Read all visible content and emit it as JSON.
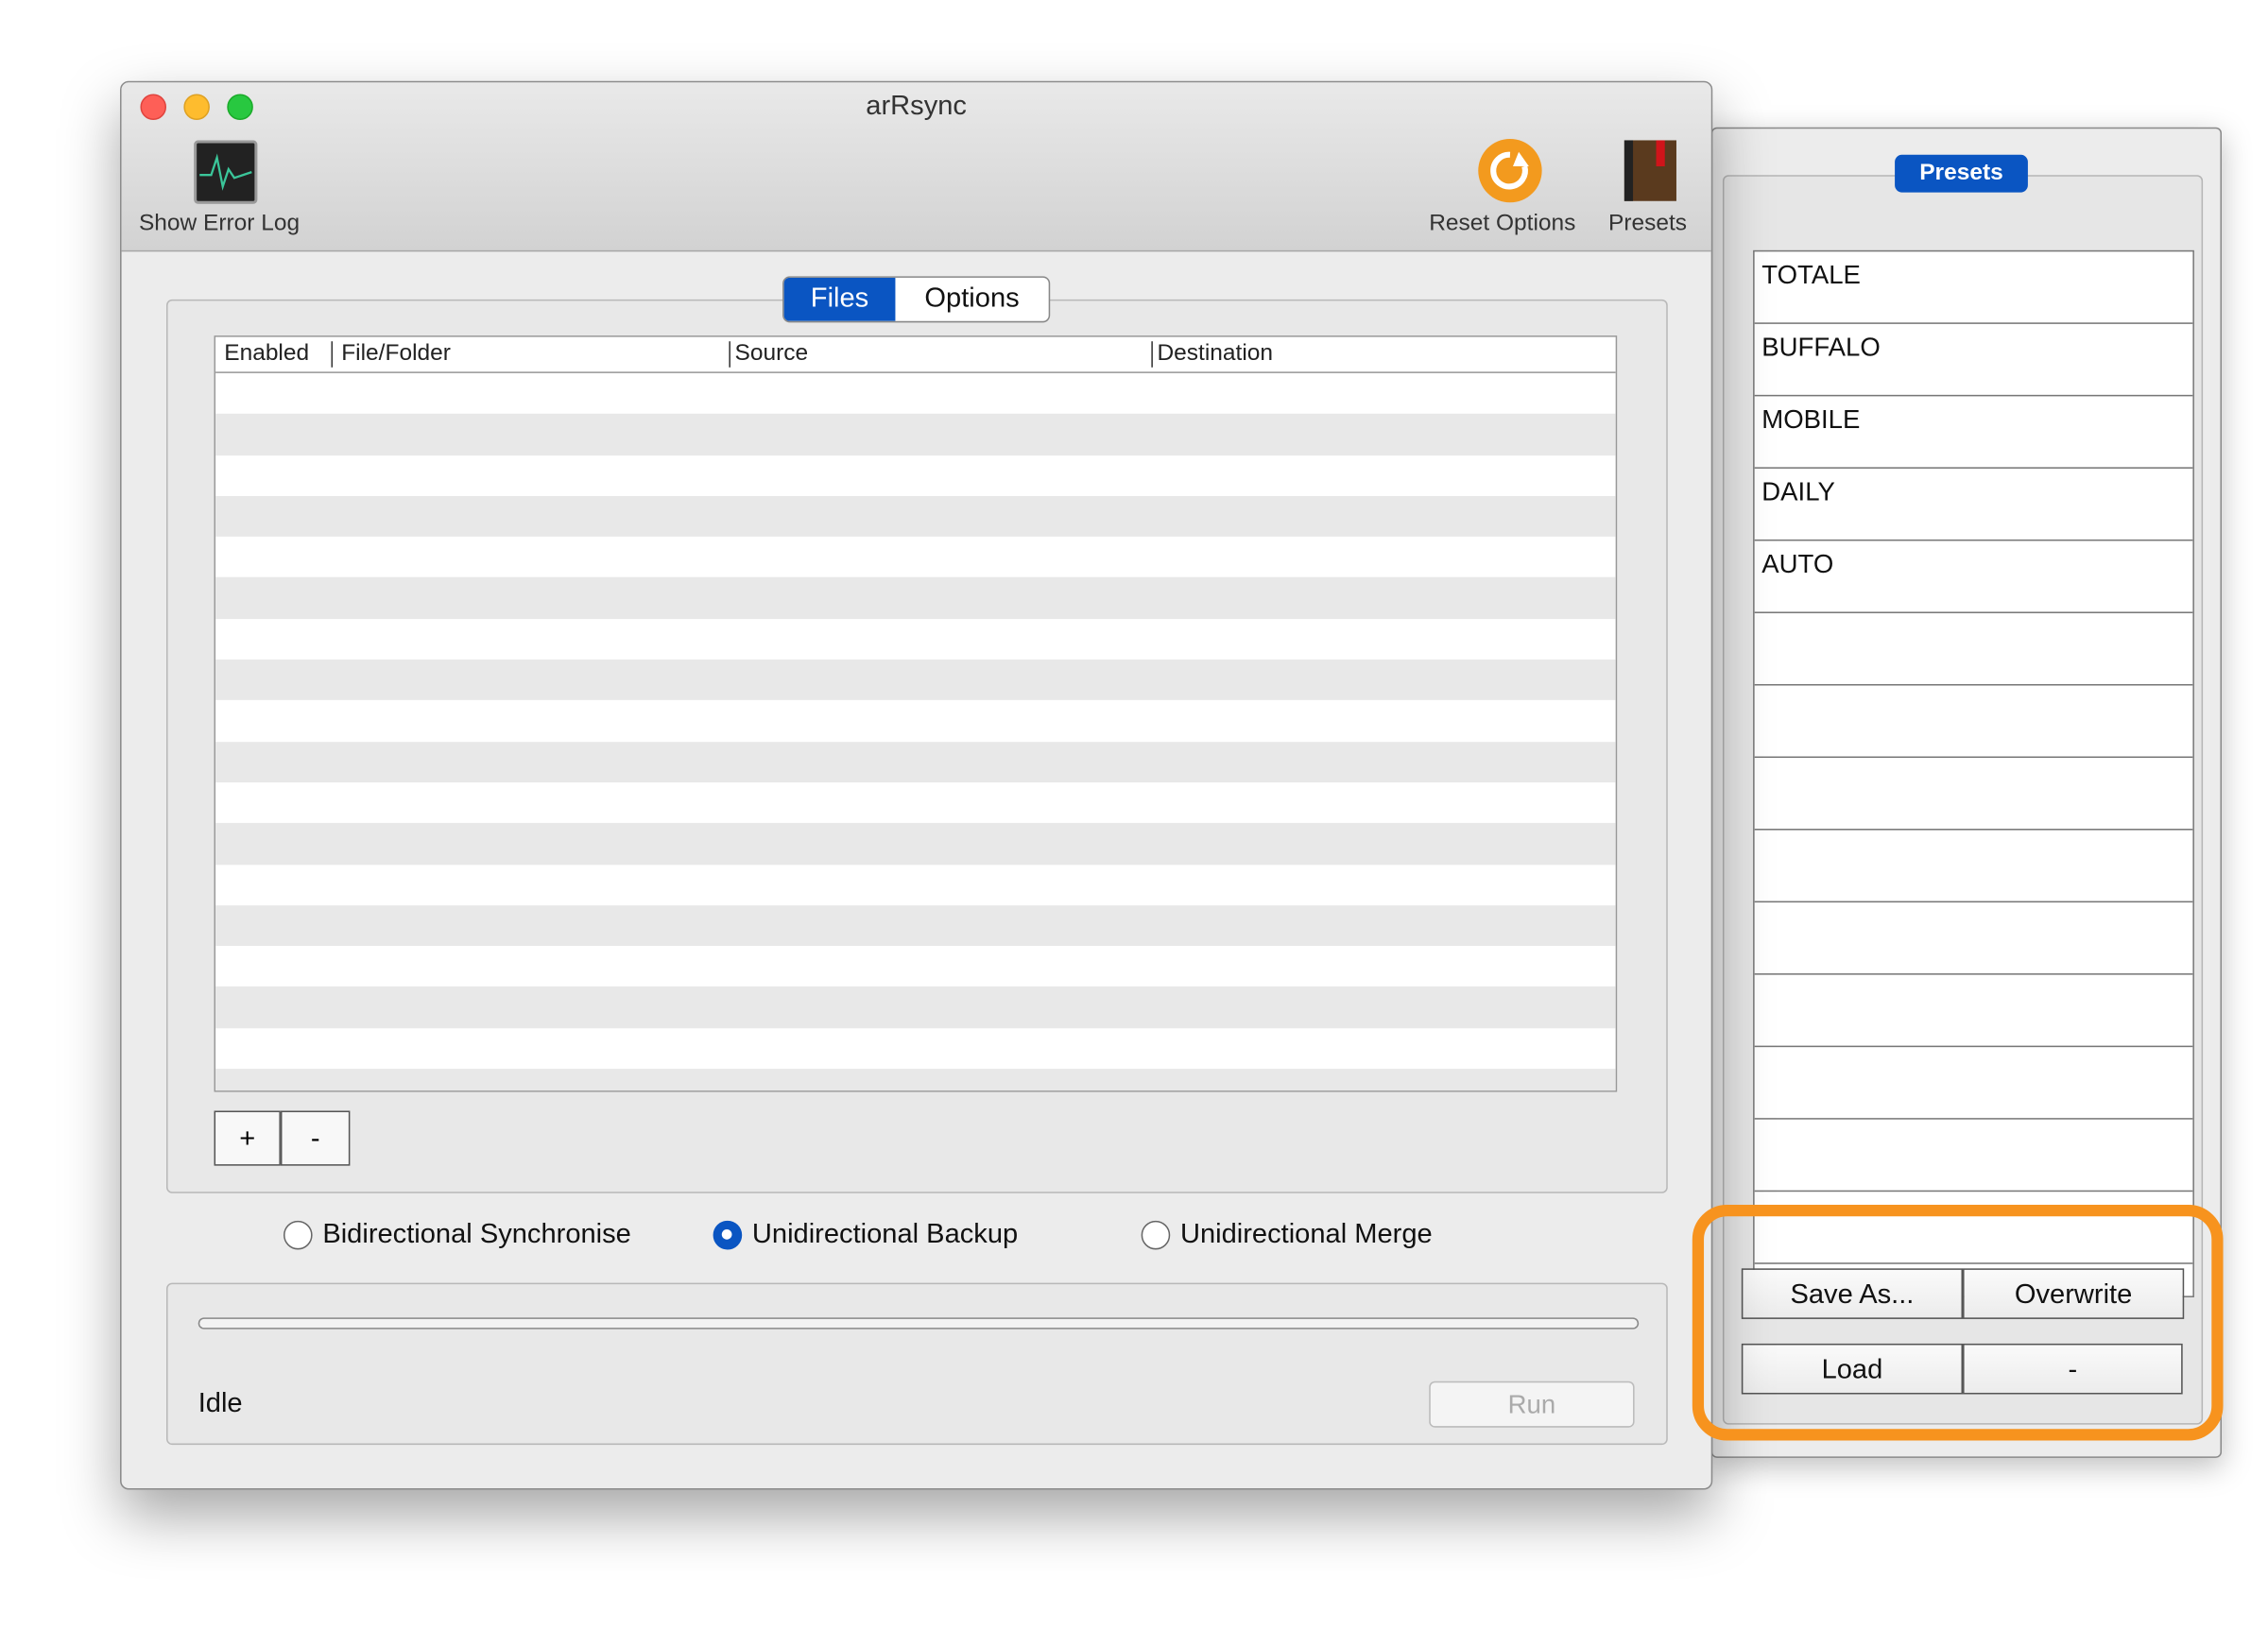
{
  "window": {
    "title": "arRsync"
  },
  "toolbar": {
    "show_error_log": "Show Error Log",
    "reset_options": "Reset Options",
    "presets": "Presets"
  },
  "tabs": [
    {
      "label": "Files",
      "selected": true
    },
    {
      "label": "Options",
      "selected": false
    }
  ],
  "table": {
    "columns": [
      "Enabled",
      "File/Folder",
      "Source",
      "Destination"
    ],
    "rows": []
  },
  "table_buttons": {
    "add": "+",
    "remove": "-"
  },
  "modes": [
    {
      "label": "Bidirectional Synchronise",
      "selected": false
    },
    {
      "label": "Unidirectional Backup",
      "selected": true
    },
    {
      "label": "Unidirectional Merge",
      "selected": false
    }
  ],
  "status": {
    "text": "Idle",
    "progress": 0,
    "run_label": "Run"
  },
  "presets_panel": {
    "title": "Presets",
    "items": [
      "TOTALE",
      "BUFFALO",
      "MOBILE",
      "DAILY",
      "AUTO"
    ],
    "save_as": "Save As...",
    "overwrite": "Overwrite",
    "load": "Load",
    "remove": "-"
  },
  "colors": {
    "accent": "#0a55c2",
    "highlight": "#f7931e"
  }
}
